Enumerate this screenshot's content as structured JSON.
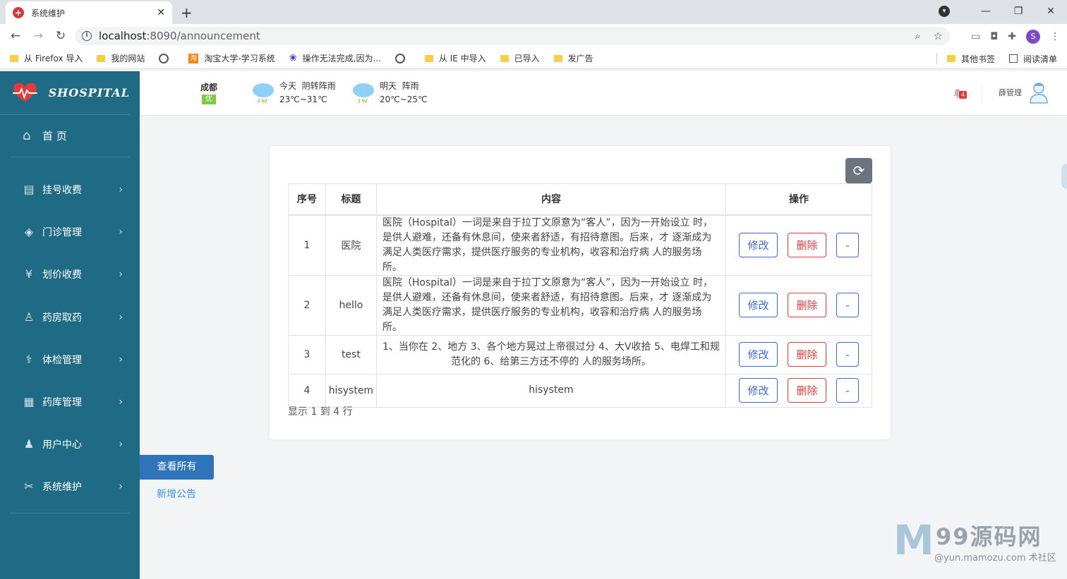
{
  "browser": {
    "tab_title": "系统维护",
    "url_host": "localhost",
    "url_path": ":8090/announcement",
    "profile_initial": "S",
    "bookmarks": [
      "从 Firefox 导入",
      "我的网站",
      "淘宝大学-学习系统",
      "操作无法完成,因为...",
      "从 IE 中导入",
      "已导入",
      "发广告"
    ],
    "bookmarks_right": [
      "其他书签",
      "阅读清单"
    ]
  },
  "sidebar": {
    "brand": "SHOSPITAL",
    "home_label": "首 页",
    "items": [
      {
        "label": "挂号收费",
        "icon": "register-icon"
      },
      {
        "label": "门诊管理",
        "icon": "outpatient-icon"
      },
      {
        "label": "划价收费",
        "icon": "pricing-icon"
      },
      {
        "label": "药房取药",
        "icon": "pharmacy-icon"
      },
      {
        "label": "体检管理",
        "icon": "stethoscope-icon"
      },
      {
        "label": "药库管理",
        "icon": "warehouse-icon"
      },
      {
        "label": "用户中心",
        "icon": "user-icon"
      },
      {
        "label": "系统维护",
        "icon": "tools-icon"
      }
    ]
  },
  "topbar": {
    "city": "成都",
    "aqi": "优",
    "today": {
      "label": "今天",
      "condition": "阴转阵雨",
      "temp": "23℃~31℃"
    },
    "tomorrow": {
      "label": "明天",
      "condition": "阵雨",
      "temp": "20℃~25℃"
    },
    "notification_count": "4",
    "username": "薛管理"
  },
  "table": {
    "headers": {
      "index": "序号",
      "title": "标题",
      "content": "内容",
      "ops": "操作"
    },
    "rows": [
      {
        "index": "1",
        "title": "医院",
        "content": "医院（Hospital）一词是来自于拉丁文原意为“客人”，因为一开始设立 时，是供人避难，还备有休息间，使来者舒适，有招待意图。后来，才 逐渐成为满足人类医疗需求，提供医疗服务的专业机构，收容和治疗病 人的服务场所。"
      },
      {
        "index": "2",
        "title": "hello",
        "content": "医院（Hospital）一词是来自于拉丁文原意为“客人”，因为一开始设立 时，是供人避难，还备有休息间，使来者舒适，有招待意图。后来，才 逐渐成为满足人类医疗需求，提供医疗服务的专业机构，收容和治疗病 人的服务场所。"
      },
      {
        "index": "3",
        "title": "test",
        "content": "1、当你在 2、地方 3、各个地方晃过上帝很过分 4、大V收拾 5、电焊工和规范化的 6、给第三方还不停的 人的服务场所。"
      },
      {
        "index": "4",
        "title": "hisystem",
        "content": "hisystem"
      }
    ],
    "edit_label": "修改",
    "delete_label": "删除",
    "more_label": "-",
    "summary": "显示 1 到 4 行"
  },
  "actions": {
    "view_all": "查看所有",
    "add_new": "新增公告"
  },
  "watermark": {
    "logo_letter": "M",
    "title": "99源码网",
    "subtitle": "@yun.mamozu.com 术社区"
  },
  "colors": {
    "sidebar": "#1f6a84",
    "primary": "#3d6bd6",
    "danger": "#e03c3c",
    "view_all": "#2f73b8"
  }
}
